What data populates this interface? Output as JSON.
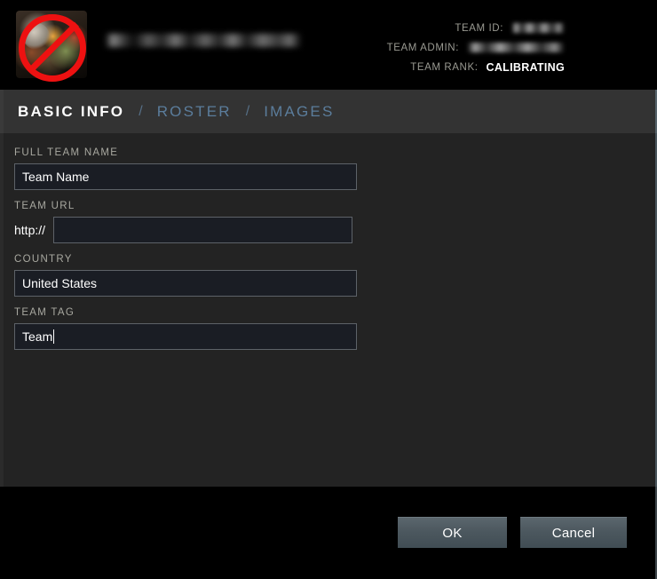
{
  "header": {
    "logo": {
      "icon": "team-logo-portrait",
      "overlay_icon": "prohibited-no-entry-icon",
      "overlay_color": "#ee1111"
    },
    "team_name": "",
    "team_name_state": "redacted",
    "meta": [
      {
        "label": "TEAM ID:",
        "value": "",
        "redacted": true
      },
      {
        "label": "TEAM ADMIN:",
        "value": "",
        "redacted": true
      },
      {
        "label": "TEAM RANK:",
        "value": "CALIBRATING",
        "redacted": false
      }
    ]
  },
  "tabs": {
    "separator": "/",
    "items": [
      {
        "label": "BASIC INFO",
        "active": true
      },
      {
        "label": "ROSTER",
        "active": false
      },
      {
        "label": "IMAGES",
        "active": false
      }
    ]
  },
  "form": {
    "fields": [
      {
        "label": "FULL TEAM NAME",
        "value": "Team Name",
        "placeholder": "",
        "prefix": ""
      },
      {
        "label": "TEAM URL",
        "value": "",
        "placeholder": "",
        "prefix": "http://"
      },
      {
        "label": "COUNTRY",
        "value": "United States",
        "placeholder": "",
        "prefix": ""
      },
      {
        "label": "TEAM TAG",
        "value": "Team",
        "placeholder": "",
        "prefix": ""
      }
    ]
  },
  "footer": {
    "ok_label": "OK",
    "cancel_label": "Cancel"
  },
  "colors": {
    "panel_bg": "#232323",
    "tabbar_bg": "#333333",
    "header_bg": "#000000",
    "input_bg": "#1a1d24",
    "input_border": "#5d6268",
    "label_text": "#a8a8a0",
    "tab_inactive": "#5b7d9c",
    "button_bg": "#4c585f",
    "ban_red": "#ee1111"
  }
}
